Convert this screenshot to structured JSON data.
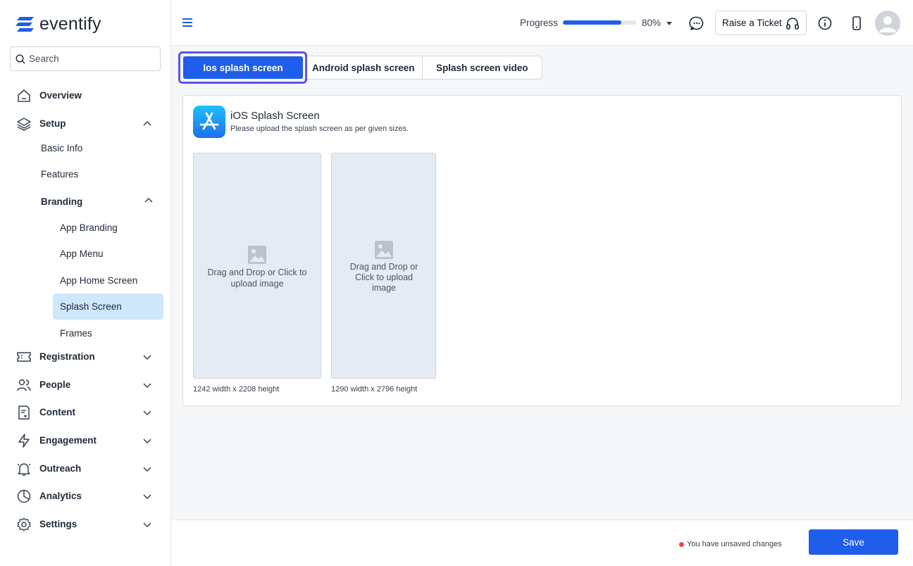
{
  "app": {
    "logo_text": "eventify"
  },
  "sidebar": {
    "search_placeholder": "Search",
    "items": [
      {
        "label": "Overview",
        "icon": "home-icon"
      },
      {
        "label": "Setup",
        "icon": "layers-icon",
        "expanded": true
      },
      {
        "label": "Registration",
        "icon": "ticket-icon"
      },
      {
        "label": "People",
        "icon": "users-icon"
      },
      {
        "label": "Content",
        "icon": "document-icon"
      },
      {
        "label": "Engagement",
        "icon": "lightning-icon"
      },
      {
        "label": "Outreach",
        "icon": "bell-icon"
      },
      {
        "label": "Analytics",
        "icon": "pie-chart-icon"
      },
      {
        "label": "Settings",
        "icon": "gear-icon"
      }
    ],
    "setup_sub": [
      "Basic Info",
      "Features",
      "Branding"
    ],
    "branding_sub": [
      "App Branding",
      "App Menu",
      "App Home Screen",
      "Splash Screen",
      "Frames"
    ],
    "active_item": "Splash Screen"
  },
  "header": {
    "progress_label": "Progress",
    "progress_value": 80,
    "progress_text": "80%",
    "ticket_label": "Raise a Ticket"
  },
  "tabs": [
    {
      "label": "Ios splash screen",
      "active": true
    },
    {
      "label": "Android splash screen",
      "active": false
    },
    {
      "label": "Splash screen video",
      "active": false
    }
  ],
  "card": {
    "title": "iOS Splash Screen",
    "subtitle": "Please upload the splash screen as per given sizes.",
    "uploads": [
      {
        "prompt": "Drag and Drop or Click to upload image",
        "size_label": "1242 width x 2208 height"
      },
      {
        "prompt": "Drag and Drop or Click to upload image",
        "size_label": "1290 width x 2796 height"
      }
    ]
  },
  "footer": {
    "unsaved_text": "You have unsaved changes",
    "save_label": "Save"
  },
  "colors": {
    "primary": "#1e5eea",
    "active_nav_bg": "#cfe7fb",
    "tab_outline": "#5d55e8",
    "unsaved_dot": "#ef4444"
  }
}
